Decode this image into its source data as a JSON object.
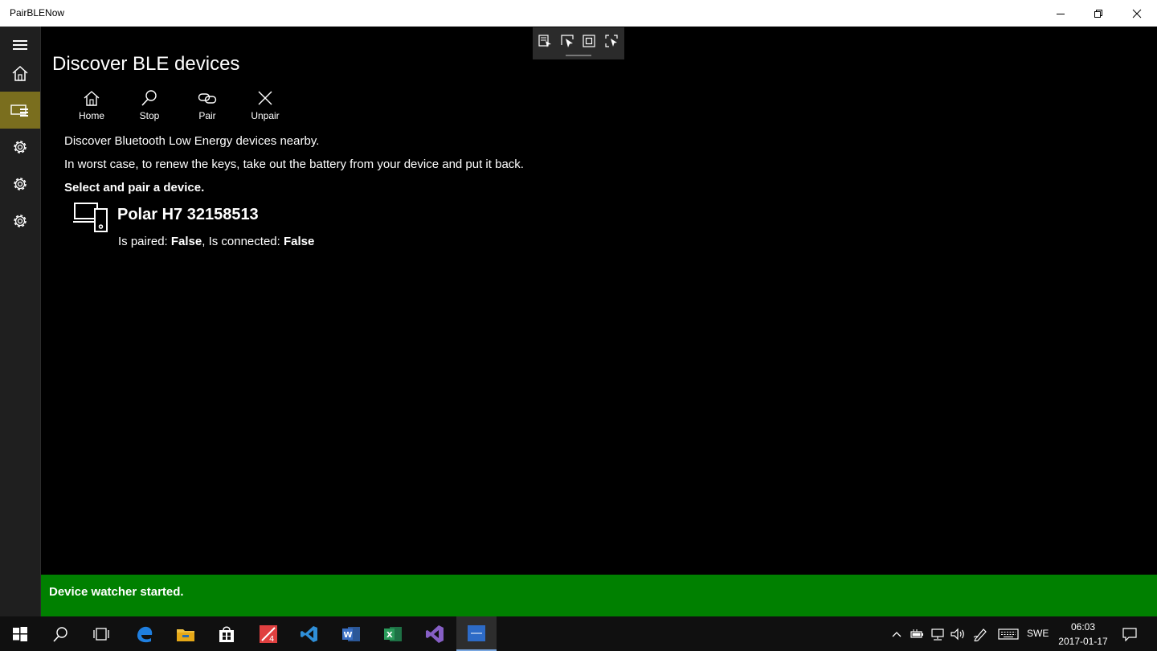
{
  "window": {
    "title": "PairBLENow"
  },
  "page": {
    "title": "Discover BLE devices",
    "commands": [
      {
        "label": "Home",
        "icon": "home-icon"
      },
      {
        "label": "Stop",
        "icon": "search-icon"
      },
      {
        "label": "Pair",
        "icon": "link-icon"
      },
      {
        "label": "Unpair",
        "icon": "close-icon"
      }
    ],
    "description_1": "Discover Bluetooth Low Energy devices nearby.",
    "description_2": "In worst case, to renew the keys, take out the battery from your device and put it back.",
    "instruction": "Select and pair a device."
  },
  "devices": [
    {
      "name": "Polar H7 32158513",
      "paired_label": "Is paired: ",
      "paired_value": "False",
      "connected_label": ", Is connected: ",
      "connected_value": "False"
    }
  ],
  "status": {
    "message": "Device watcher started.",
    "color": "#008000"
  },
  "taskbar": {
    "language": "SWE",
    "time": "06:03",
    "date": "2017-01-17"
  },
  "colors": {
    "accent_nav": "#7a6e1e",
    "status_bg": "#008000"
  }
}
